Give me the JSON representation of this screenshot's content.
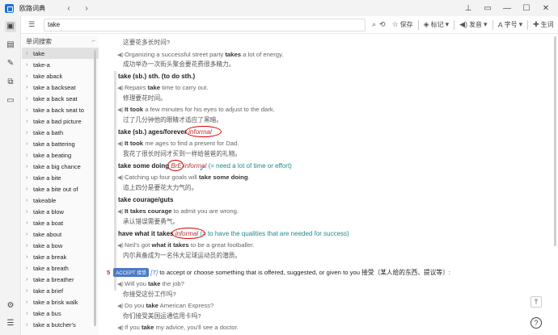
{
  "window": {
    "title": "欧路词典",
    "back_glyph": "‹",
    "forward_glyph": "›",
    "pin_glyph": "⊥",
    "restore_glyph": "▭",
    "minimize_glyph": "—",
    "maximize_glyph": "☐",
    "close_glyph": "✕"
  },
  "search": {
    "value": "take",
    "menu_glyph": "☰"
  },
  "toolbar": {
    "search_icon": "⌕",
    "clear_icon": "⟲",
    "save_icon": "☆",
    "save_label": "保存",
    "mark_icon": "◈",
    "mark_label": "标记",
    "mark_arrow": "▾",
    "speak_icon": "◀)",
    "speak_label": "发音",
    "speak_arrow": "▾",
    "font_icon": "A",
    "font_label": "字号",
    "font_arrow": "▾",
    "vocab_icon": "✚",
    "vocab_label": "生词"
  },
  "sidebar_icons": [
    "▣",
    "▤",
    "✎",
    "⧉",
    "▭",
    "⚙",
    "☰"
  ],
  "wordlist": {
    "heading": "单词搜索",
    "pin": "⌐",
    "items": [
      "take",
      "take-a",
      "take aback",
      "take a backseat",
      "take a back seat",
      "take a back seat to",
      "take a bad picture",
      "take a bath",
      "take a battering",
      "take a beating",
      "take a big chance",
      "take a bite",
      "take a bite out of",
      "takeable",
      "take a blow",
      "take a boat",
      "take about",
      "take a bow",
      "take a break",
      "take a breath",
      "take a breather",
      "take a brief",
      "take a brisk walk",
      "take a bus",
      "take a butcher's"
    ]
  },
  "entry": {
    "r1": {
      "zh": "这要花多长时间?"
    },
    "r2": {
      "pre": "Organizing a successful street party ",
      "b": "takes",
      "post": " a lot of energy."
    },
    "r3": {
      "zh": "成功举办一次街头聚会要花费很多精力。"
    },
    "h1": {
      "text": "take (sb.) sth. (to do sth.)"
    },
    "r4": {
      "pre": "Repairs ",
      "b": "take",
      "post": " time to carry out."
    },
    "r5": {
      "zh": "修理要花时间。"
    },
    "r6": {
      "pre": "",
      "b": "It took",
      "post": " a few minutes for his eyes to adjust to the dark."
    },
    "r7": {
      "zh": "过了几分钟他的眼睛才适应了黑暗。"
    },
    "h2": {
      "text": "take (sb.) ages/forever ",
      "reg": "informal"
    },
    "r8": {
      "pre": "",
      "b": "It took",
      "post": " me ages to find a present for Dad."
    },
    "r9": {
      "zh": "我花了很长时间才买到一样给爸爸的礼物。"
    },
    "h3": {
      "text": "take some doing ",
      "reg": "BrE informal",
      "gloss": " (= need a lot of time or effort)"
    },
    "r10": {
      "pre": "Catching up four goals will ",
      "b": "take some doing",
      "post": "."
    },
    "r11": {
      "zh": "追上四分是要花大力气的。"
    },
    "h4": {
      "text": "take courage/guts"
    },
    "r12": {
      "pre": "",
      "b": "It takes courage",
      "post": " to admit you are wrong."
    },
    "r13": {
      "zh": "承认错误需要勇气。"
    },
    "h5": {
      "text": "have what it takes ",
      "reg": "informal",
      "gloss": " (= to have the qualities that are needed for success)"
    },
    "r14": {
      "pre": "Neil's got ",
      "b": "what it takes",
      "post": " to be a great footballer."
    },
    "r15": {
      "zh": "内尔具备成为一名伟大足球运动员的潜质。"
    },
    "s5": {
      "num": "5",
      "badge": "ACCEPT 接受",
      "tag": "[T]",
      "def": " to accept or choose something that is offered, suggested, or given to you  接受〔某人给的东西、提议等〕:"
    },
    "r16": {
      "pre": "Will you ",
      "b": "take",
      "post": " the job?"
    },
    "r17": {
      "zh": "你接受这份工作吗?"
    },
    "r18": {
      "pre": "Do you ",
      "b": "take",
      "post": " American Express?"
    },
    "r19": {
      "zh": "你们接受美国运通信用卡吗?"
    },
    "r20": {
      "pre": "If you ",
      "b": "take",
      "post": " my advice, you'll see a doctor."
    },
    "speaker": "◀)",
    "check": "✓"
  },
  "buttons": {
    "scroll_top": "⤒",
    "help": "?"
  }
}
